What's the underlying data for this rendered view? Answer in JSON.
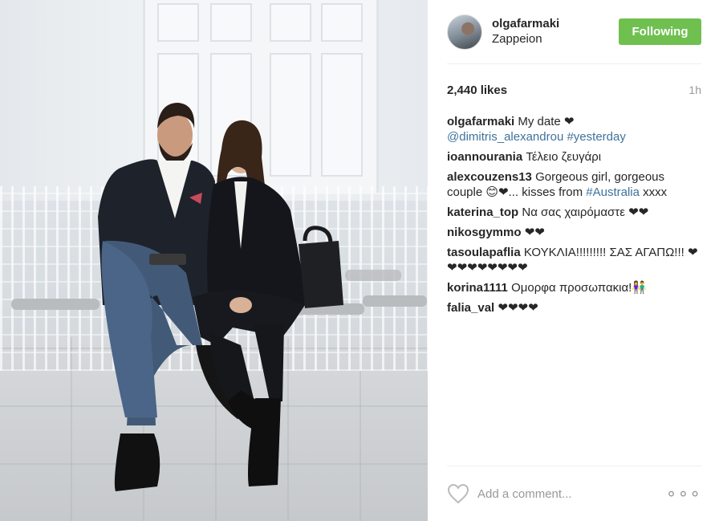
{
  "post": {
    "username": "olgafarmaki",
    "location": "Zappeion",
    "follow_label": "Following",
    "likes": "2,440 likes",
    "time": "1h",
    "add_comment_placeholder": "Add a comment...",
    "more_label": "∘∘∘",
    "accent_color": "#70c050",
    "link_color": "#3f729b"
  },
  "caption": {
    "user": "olgafarmaki",
    "text": "My date ❤",
    "mention": "@dimitris_alexandrou",
    "hashtag": "#yesterday"
  },
  "comments": [
    {
      "user": "ioannourania",
      "text": "Τέλειο ζευγάρι"
    },
    {
      "user": "alexcouzens13",
      "text": "Gorgeous girl, gorgeous couple 😊❤... kisses from ",
      "hashtag": "#Australia",
      "text_after": " xxxx"
    },
    {
      "user": "katerina_top",
      "text": "Να σας χαιρόμαστε ❤❤"
    },
    {
      "user": "nikosgymmo",
      "text": "❤❤"
    },
    {
      "user": "tasoulapaflia",
      "text": "ΚΟΥΚΛΙΑ!!!!!!!!! ΣΑΣ ΑΓΑΠΩ!!! ❤❤❤❤❤❤❤❤❤"
    },
    {
      "user": "korina1111",
      "text": "Ομορφα προσωπακια!👫"
    },
    {
      "user": "falia_val",
      "text": "❤❤❤❤"
    }
  ],
  "icons": {
    "like": "heart-outline-icon",
    "more": "more-options-icon"
  }
}
